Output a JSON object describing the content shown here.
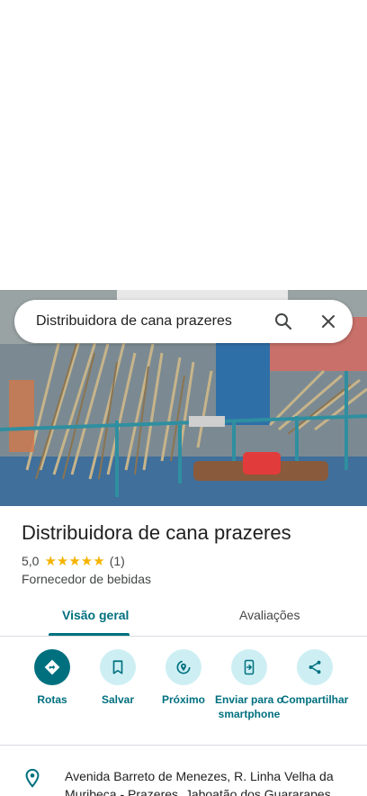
{
  "search": {
    "query": "Distribuidora de cana prazeres"
  },
  "place": {
    "name": "Distribuidora de cana prazeres",
    "rating": "5,0",
    "stars": "★★★★★",
    "review_count": "(1)",
    "category": "Fornecedor de bebidas"
  },
  "tabs": [
    {
      "label": "Visão geral",
      "selected": true
    },
    {
      "label": "Avaliações",
      "selected": false
    }
  ],
  "actions": [
    {
      "label": "Rotas",
      "icon": "directions-icon"
    },
    {
      "label": "Salvar",
      "icon": "bookmark-icon"
    },
    {
      "label": "Próximo",
      "icon": "nearby-icon"
    },
    {
      "label": "Enviar para o smartphone",
      "icon": "send-to-phone-icon"
    },
    {
      "label": "Compartilhar",
      "icon": "share-icon"
    }
  ],
  "address": "Avenida Barreto de Menezes, R. Linha Velha da Muribeca - Prazeres, Jaboatão dos Guararapes",
  "colors": {
    "accent": "#00707f",
    "accent_light": "#cdeff4",
    "star": "#f6b300"
  }
}
